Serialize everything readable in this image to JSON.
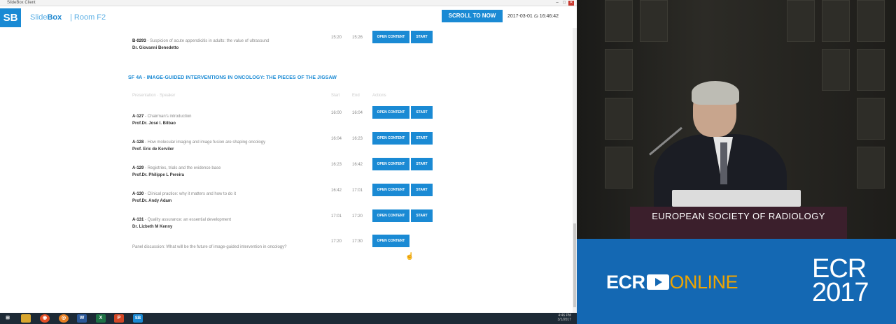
{
  "window": {
    "title": "SlideBox Client",
    "controls": [
      "–",
      "□",
      "✕"
    ]
  },
  "header": {
    "logo": "SB",
    "brand_light": "Slide",
    "brand_bold": "Box",
    "room": "| Room F2",
    "scroll_button": "SCROLL TO NOW",
    "datetime": "2017-03-01 ◷ 16:46:42"
  },
  "prev_row": {
    "code": "B-0293",
    "title": " - Suspicion of acute appendicitis in adults: the value of ultrasound",
    "speaker": "Dr. Giovanni Benedetto",
    "start": "15:20",
    "end": "15:26",
    "open_label": "OPEN CONTENT",
    "start_label": "START"
  },
  "session": {
    "title": "SF 4A - IMAGE-GUIDED INTERVENTIONS IN ONCOLOGY: THE PIECES OF THE JIGSAW",
    "col_presentation": "Presentation · Speaker",
    "col_start": "Start",
    "col_end": "End",
    "col_actions": "Actions",
    "rows": [
      {
        "code": "A-127",
        "title": " - Chairman's introduction",
        "speaker": "Prof.Dr. José I. Bilbao",
        "start": "16:00",
        "end": "16:04",
        "open_label": "OPEN CONTENT",
        "start_label": "START"
      },
      {
        "code": "A-128",
        "title": " - How molecular imaging and image fusion are shaping oncology",
        "speaker": "Prof. Eric de Kerviler",
        "start": "16:04",
        "end": "16:23",
        "open_label": "OPEN CONTENT",
        "start_label": "START"
      },
      {
        "code": "A-129",
        "title": " - Registries, trials and the evidence base",
        "speaker": "Prof.Dr. Philippe L Pereira",
        "start": "16:23",
        "end": "16:42",
        "open_label": "OPEN CONTENT",
        "start_label": "START"
      },
      {
        "code": "A-130",
        "title": " - Clinical practice: why it matters and how to do it",
        "speaker": "Prof.Dr. Andy Adam",
        "start": "16:42",
        "end": "17:01",
        "open_label": "OPEN CONTENT",
        "start_label": "START"
      },
      {
        "code": "A-131",
        "title": " - Quality assurance: an essential development",
        "speaker": "Dr. Lizbeth M Kenny",
        "start": "17:01",
        "end": "17:20",
        "open_label": "OPEN CONTENT",
        "start_label": "START"
      }
    ],
    "panel": {
      "title": "Panel discussion: What will be the future of image-guided intervention in oncology?",
      "start": "17:20",
      "end": "17:30",
      "open_label": "OPEN CONTENT"
    }
  },
  "taskbar": {
    "items": [
      "⊞",
      "",
      "◉",
      "◎",
      "W",
      "X",
      "P",
      "SB"
    ],
    "item_colors": [
      "#1d2a36",
      "#d9a62e",
      "#e34f26",
      "#e67e22",
      "#2b5797",
      "#1e7145",
      "#d24726",
      "#1a8ad4"
    ],
    "clock": "4:46 PM",
    "date": "3/1/2017"
  },
  "video": {
    "podium_text": "EUROPEAN SOCIETY OF RADIOLOGY"
  },
  "branding": {
    "ecr": "ECR",
    "online": "ONLINE",
    "ecr_year_top": "ECR",
    "ecr_year_bottom": "2017"
  },
  "colors": {
    "accent": "#1a8ad4",
    "brand_blue": "#1468b3",
    "podium": "#3b1f2c",
    "online_orange": "#f0a500"
  }
}
